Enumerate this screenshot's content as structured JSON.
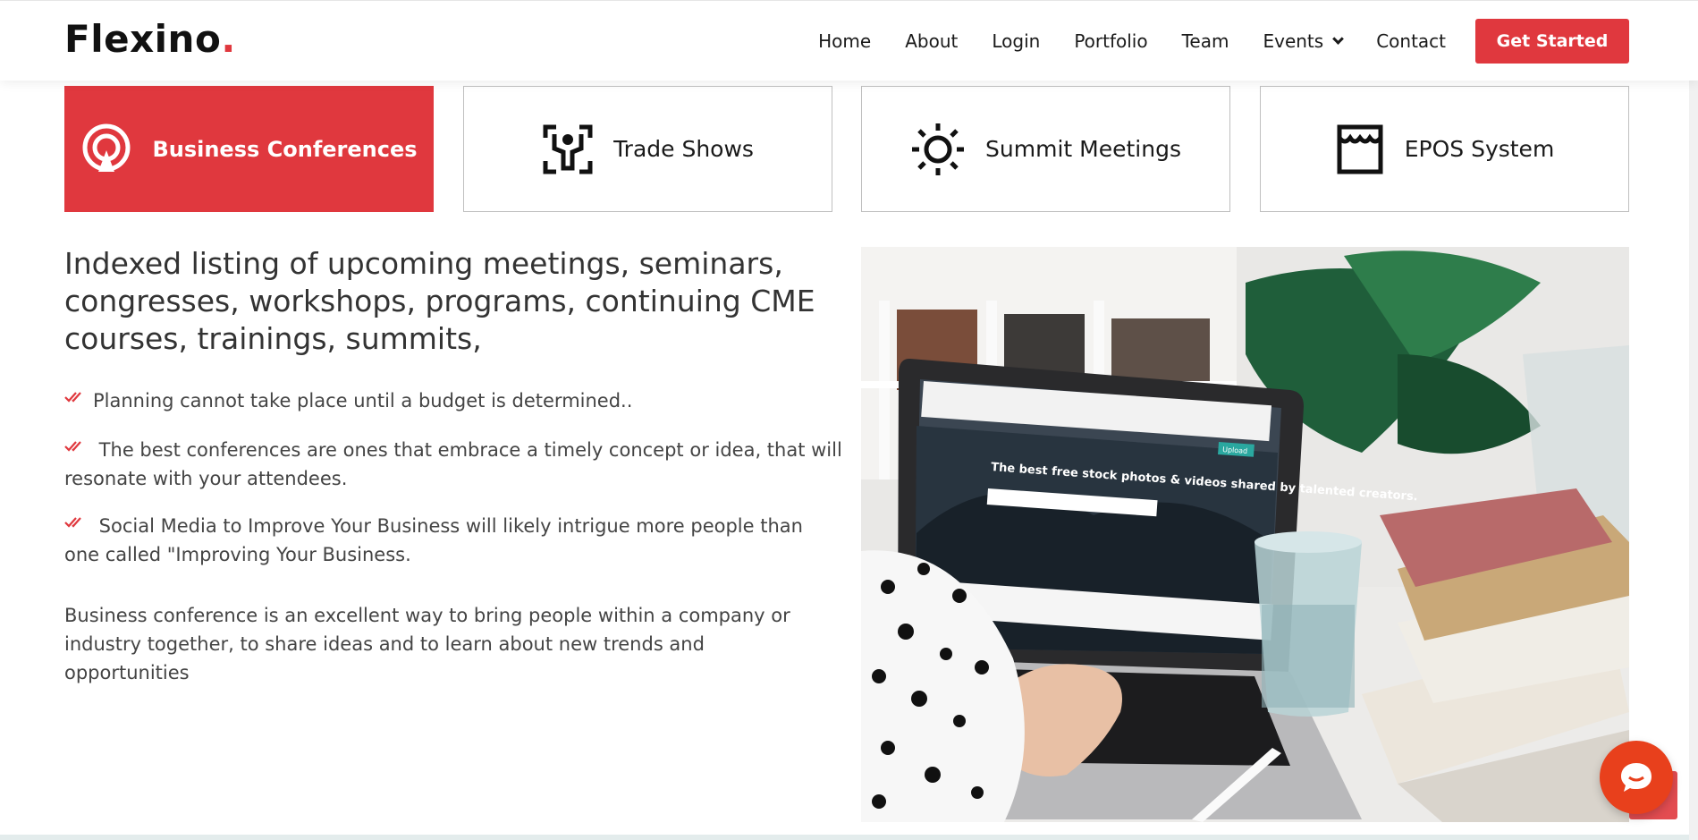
{
  "header": {
    "logo_text": "Flexino",
    "logo_dot": ".",
    "nav": [
      "Home",
      "About",
      "Login",
      "Portfolio",
      "Team",
      "Events",
      "Contact"
    ],
    "cta_label": "Get Started"
  },
  "tabs": [
    {
      "label": "Business Conferences",
      "icon": "broadcast-icon",
      "active": true
    },
    {
      "label": "Trade Shows",
      "icon": "exhibitor-icon",
      "active": false
    },
    {
      "label": "Summit Meetings",
      "icon": "sun-icon",
      "active": false
    },
    {
      "label": "EPOS System",
      "icon": "store-icon",
      "active": false
    }
  ],
  "content": {
    "heading": "Indexed listing of upcoming meetings, seminars, congresses, workshops, programs, continuing CME courses, trainings, summits,",
    "bullets": [
      "Planning cannot take place until a budget is determined..",
      " The best conferences are ones that embrace a timely concept or idea, that will resonate with your attendees.",
      " Social Media to Improve Your Business will likely intrigue more people than one called \"Improving Your Business."
    ],
    "paragraph": "Business conference is an excellent way to bring people within a company or industry together, to share ideas and to learn about new trends and opportunities"
  },
  "photo": {
    "screen_headline": "The best free stock photos & videos shared by talented creators.",
    "screen_button": "Upload"
  },
  "colors": {
    "accent": "#e0383e",
    "chat": "#e8401c"
  }
}
